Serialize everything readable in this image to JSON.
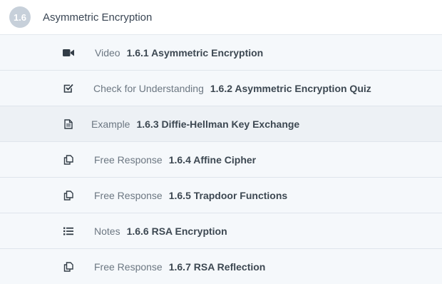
{
  "header": {
    "badge": "1.6",
    "title": "Asymmetric Encryption"
  },
  "items": [
    {
      "icon": "video-icon",
      "type": "Video",
      "title": "1.6.1 Asymmetric Encryption"
    },
    {
      "icon": "checkbox-icon",
      "type": "Check for Understanding",
      "title": "1.6.2 Asymmetric Encryption Quiz"
    },
    {
      "icon": "document-icon",
      "type": "Example",
      "title": "1.6.3 Diffie-Hellman Key Exchange"
    },
    {
      "icon": "copy-icon",
      "type": "Free Response",
      "title": "1.6.4 Affine Cipher"
    },
    {
      "icon": "copy-icon",
      "type": "Free Response",
      "title": "1.6.5 Trapdoor Functions"
    },
    {
      "icon": "list-icon",
      "type": "Notes",
      "title": "1.6.6 RSA Encryption"
    },
    {
      "icon": "copy-icon",
      "type": "Free Response",
      "title": "1.6.7 RSA Reflection"
    }
  ]
}
